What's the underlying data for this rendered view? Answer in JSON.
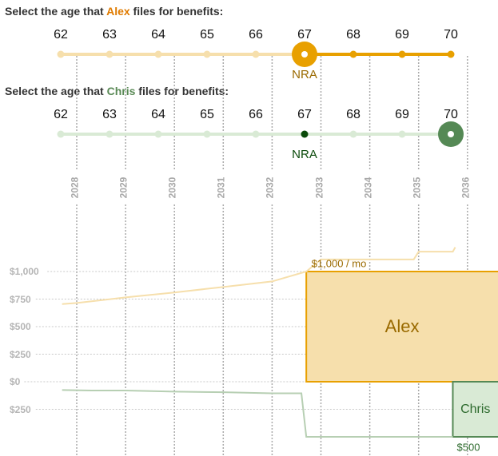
{
  "alex_prompt": {
    "prefix": "Select the age that ",
    "name": "Alex",
    "suffix": " files for benefits:"
  },
  "chris_prompt": {
    "prefix": "Select the age that ",
    "name": "Chris",
    "suffix": " files for benefits:"
  },
  "ages": [
    "62",
    "63",
    "64",
    "65",
    "66",
    "67",
    "68",
    "69",
    "70"
  ],
  "alex_slider": {
    "selected_age": 67,
    "nra_age": 67,
    "nra_label": "NRA"
  },
  "chris_slider": {
    "selected_age": 70,
    "nra_age": 67,
    "nra_label": "NRA"
  },
  "colors": {
    "alex_accent": "#e8a000",
    "alex_light": "#f6dfac",
    "alex_text": "#9a6a00",
    "alex_fill": "#f6dfac",
    "chris_accent": "#558955",
    "chris_light": "#d9ead5",
    "chris_dark": "#0a4a0a",
    "chris_text": "#2d6a2d",
    "chris_fill": "#d9ead5",
    "grid": "#aaaaaa"
  },
  "chart_data": {
    "type": "line",
    "title": "",
    "xlabel": "",
    "ylabel": "",
    "x_ticks": [
      "2028",
      "2029",
      "2030",
      "2031",
      "2032",
      "2033",
      "2034",
      "2035",
      "2036"
    ],
    "y_ticks": [
      "$1,000",
      "$750",
      "$500",
      "$250",
      "$0",
      "$250"
    ],
    "y_tick_values": [
      1000,
      750,
      500,
      250,
      0,
      -250
    ],
    "ylim": [
      -500,
      1000
    ],
    "grid": true,
    "series": [
      {
        "name": "Alex",
        "x": [
          2027.7,
          2028,
          2029,
          2030,
          2031,
          2032,
          2032.7,
          2033,
          2034,
          2034.9,
          2035,
          2035.7,
          2035.75
        ],
        "values": [
          705,
          715,
          765,
          810,
          860,
          910,
          1000,
          1110,
          1110,
          1110,
          1180,
          1180,
          1220
        ]
      },
      {
        "name": "Chris",
        "x": [
          2027.7,
          2028.3,
          2029,
          2030,
          2031,
          2032,
          2032.6,
          2032.7,
          2035.7
        ],
        "values": [
          -75,
          -80,
          -80,
          -90,
          -95,
          -105,
          -105,
          -500,
          -500
        ]
      }
    ],
    "boxes": [
      {
        "name": "Alex",
        "label": "Alex",
        "value": 1000,
        "value_label": "$1,000 / mo",
        "start_year": 2032.7
      },
      {
        "name": "Chris",
        "label": "Chris",
        "value": 500,
        "value_label": "$500",
        "start_year": 2035.7
      }
    ]
  }
}
